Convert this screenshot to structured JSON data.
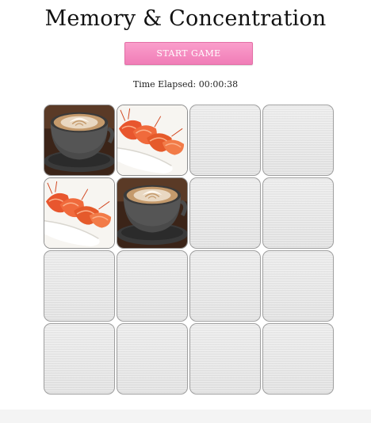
{
  "game": {
    "title": "Memory & Concentration",
    "start_label": "START GAME",
    "timer_text": "Time Elapsed: 00:00:38"
  },
  "board": {
    "rows": 4,
    "columns": 4,
    "cards": [
      {
        "state": "face-up",
        "picture": "coffee-cup"
      },
      {
        "state": "face-up",
        "picture": "shrimp-dish"
      },
      {
        "state": "face-down",
        "picture": ""
      },
      {
        "state": "face-down",
        "picture": ""
      },
      {
        "state": "face-up",
        "picture": "shrimp-dish"
      },
      {
        "state": "face-up",
        "picture": "coffee-cup"
      },
      {
        "state": "face-down",
        "picture": ""
      },
      {
        "state": "face-down",
        "picture": ""
      },
      {
        "state": "face-down",
        "picture": ""
      },
      {
        "state": "face-down",
        "picture": ""
      },
      {
        "state": "face-down",
        "picture": ""
      },
      {
        "state": "face-down",
        "picture": ""
      },
      {
        "state": "face-down",
        "picture": ""
      },
      {
        "state": "face-down",
        "picture": ""
      },
      {
        "state": "face-down",
        "picture": ""
      },
      {
        "state": "face-down",
        "picture": ""
      }
    ]
  },
  "colors": {
    "start_button": "#f48cc0",
    "card_back": "#e8e8e8",
    "card_border": "#9e9e9e"
  }
}
